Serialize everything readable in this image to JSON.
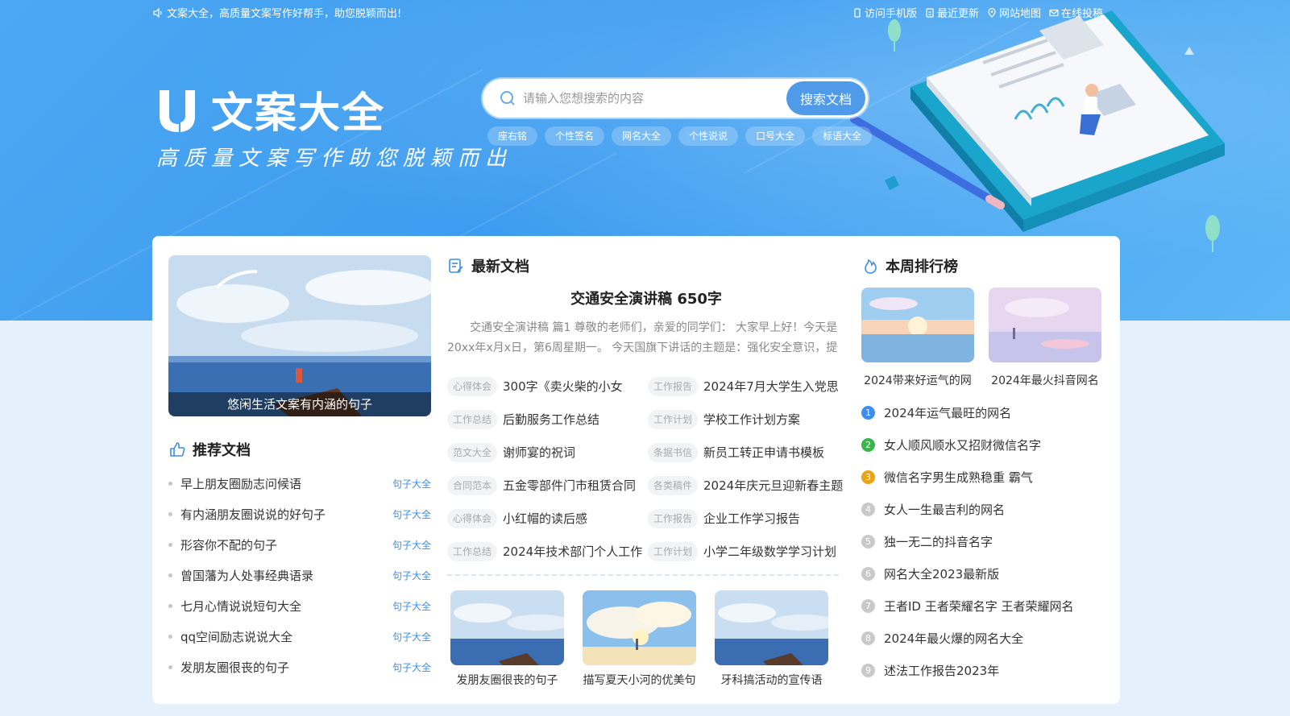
{
  "topbar": {
    "slogan": "文案大全，高质量文案写作好帮手，助您脱颖而出!",
    "links": [
      {
        "icon": "mobile-icon",
        "label": "访问手机版"
      },
      {
        "icon": "document-icon",
        "label": "最近更新"
      },
      {
        "icon": "location-icon",
        "label": "网站地图"
      },
      {
        "icon": "mail-icon",
        "label": "在线投稿"
      }
    ]
  },
  "brand": {
    "logo_text": "文案大全",
    "tagline": "高质量文案写作助您脱颖而出"
  },
  "search": {
    "placeholder": "请输入您想搜索的内容",
    "button": "搜索文档",
    "hot_tags": [
      "座右铭",
      "个性签名",
      "网名大全",
      "个性说说",
      "口号大全",
      "标语大全"
    ]
  },
  "feature": {
    "caption": "悠闲生活文案有内涵的句子"
  },
  "recommended": {
    "heading": "推荐文档",
    "items": [
      {
        "title": "早上朋友圈励志问候语",
        "category": "句子大全"
      },
      {
        "title": "有内涵朋友圈说说的好句子",
        "category": "句子大全"
      },
      {
        "title": "形容你不配的句子",
        "category": "句子大全"
      },
      {
        "title": "曾国藩为人处事经典语录",
        "category": "句子大全"
      },
      {
        "title": "七月心情说说短句大全",
        "category": "句子大全"
      },
      {
        "title": "qq空间励志说说大全",
        "category": "句子大全"
      },
      {
        "title": "发朋友圈很丧的句子",
        "category": "句子大全"
      }
    ]
  },
  "latest": {
    "heading": "最新文档",
    "top_title": "交通安全演讲稿 650字",
    "top_summary": "交通安全演讲稿 篇1 尊敬的老师们，亲爱的同学们：  大家早上好！今天是20xx年x月x日，第6周星期一。 今天国旗下讲话的主题是：强化安全意识，提",
    "docs": [
      {
        "tag": "心得体会",
        "title": "300字《卖火柴的小女"
      },
      {
        "tag": "工作报告",
        "title": "2024年7月大学生入党思"
      },
      {
        "tag": "工作总结",
        "title": "后勤服务工作总结"
      },
      {
        "tag": "工作计划",
        "title": "学校工作计划方案"
      },
      {
        "tag": "范文大全",
        "title": "谢师宴的祝词"
      },
      {
        "tag": "条据书信",
        "title": "新员工转正申请书模板"
      },
      {
        "tag": "合同范本",
        "title": "五金零部件门市租赁合同"
      },
      {
        "tag": "各类稿件",
        "title": "2024年庆元旦迎新春主题"
      },
      {
        "tag": "心得体会",
        "title": "小红帽的读后感"
      },
      {
        "tag": "工作报告",
        "title": "企业工作学习报告"
      },
      {
        "tag": "工作总结",
        "title": "2024年技术部门个人工作"
      },
      {
        "tag": "工作计划",
        "title": "小学二年级数学学习计划"
      }
    ],
    "thumbs": [
      {
        "title": "发朋友圈很丧的句子"
      },
      {
        "title": "描写夏天小河的优美句"
      },
      {
        "title": "牙科搞活动的宣传语"
      }
    ]
  },
  "weekly": {
    "heading": "本周排行榜",
    "thumbs": [
      {
        "title": "2024带来好运气的网"
      },
      {
        "title": "2024年最火抖音网名"
      }
    ],
    "ranks": [
      {
        "n": "1",
        "title": "2024年运气最旺的网名"
      },
      {
        "n": "2",
        "title": "女人顺风顺水又招财微信名字"
      },
      {
        "n": "3",
        "title": "微信名字男生成熟稳重 霸气"
      },
      {
        "n": "4",
        "title": "女人一生最吉利的网名"
      },
      {
        "n": "5",
        "title": "独一无二的抖音名字"
      },
      {
        "n": "6",
        "title": "网名大全2023最新版"
      },
      {
        "n": "7",
        "title": "王者ID 王者荣耀名字 王者荣耀网名"
      },
      {
        "n": "8",
        "title": "2024年最火爆的网名大全"
      },
      {
        "n": "9",
        "title": "述法工作报告2023年"
      }
    ]
  },
  "colors": {
    "accent": "#3d8ef0",
    "banner": "#46a3f1",
    "rank1": "#3d8ef0",
    "rank2": "#39b54a",
    "rank3": "#e8a317"
  }
}
